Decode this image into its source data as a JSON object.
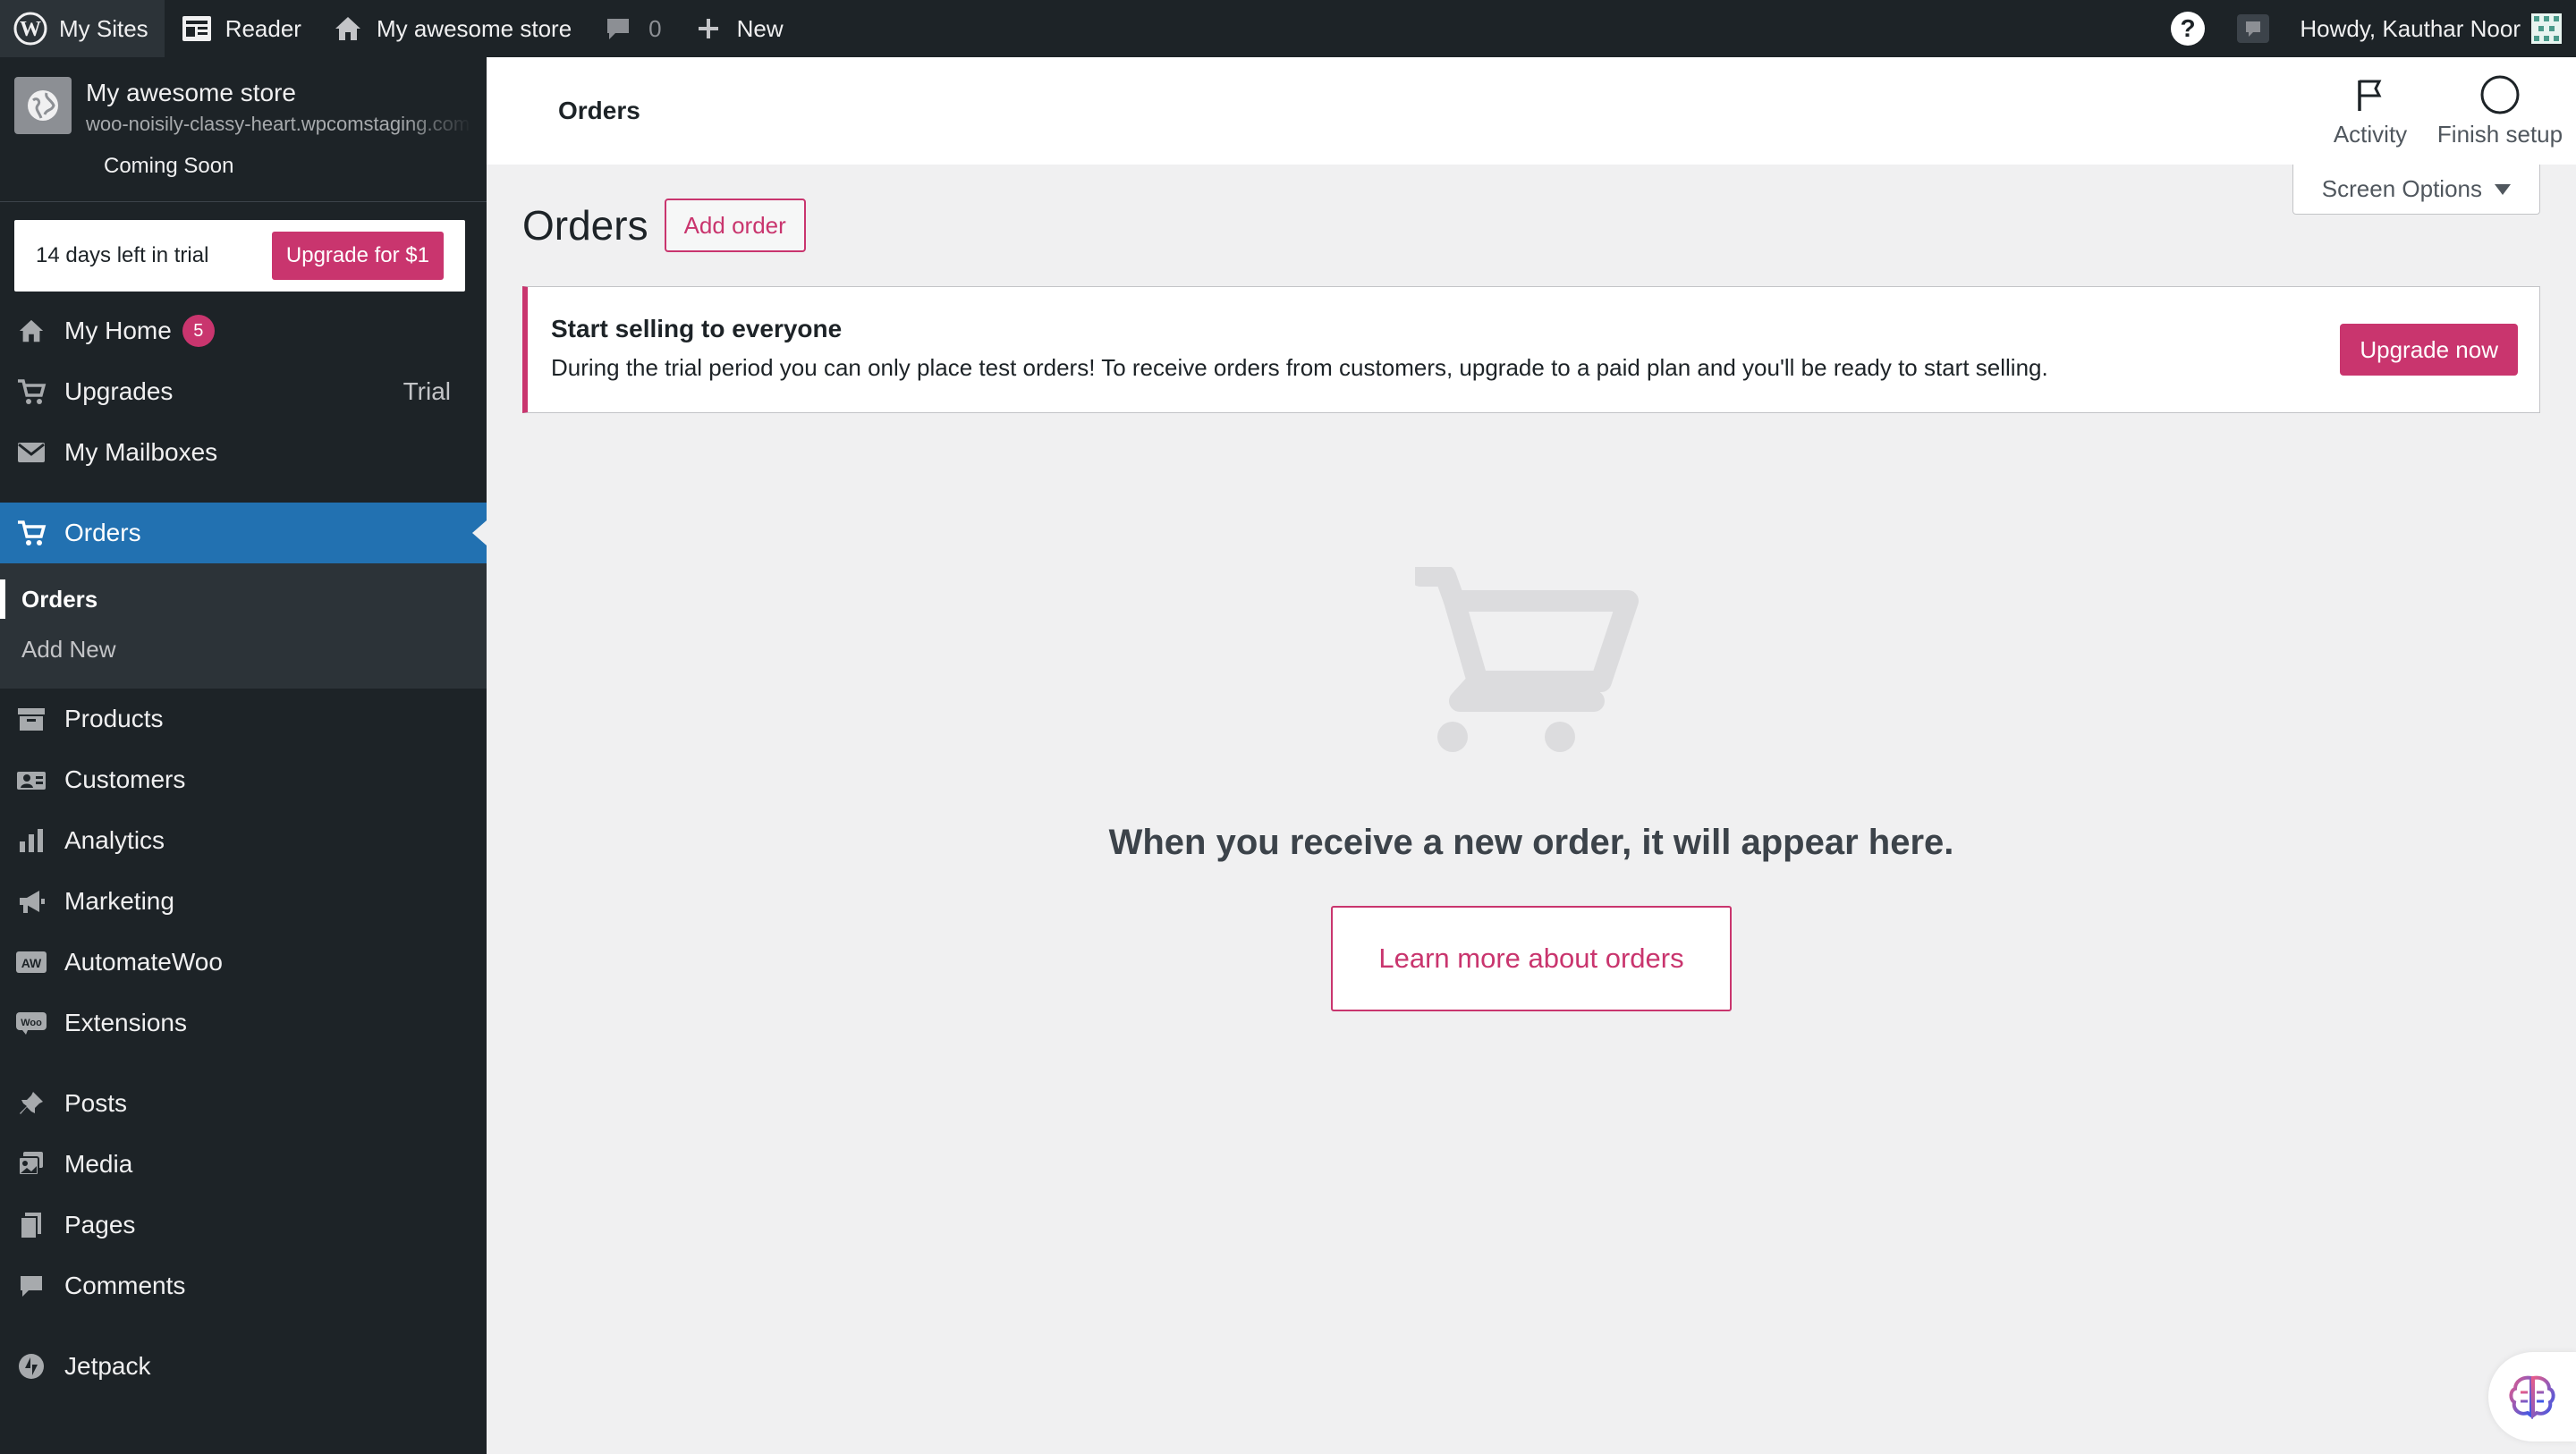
{
  "adminbar": {
    "my_sites": "My Sites",
    "reader": "Reader",
    "site": "My awesome store",
    "comments_count": "0",
    "new": "New",
    "howdy": "Howdy, Kauthar Noor"
  },
  "sidebar": {
    "site_name": "My awesome store",
    "site_url": "woo-noisily-classy-heart.wpcomstaging.com",
    "site_status": "Coming Soon",
    "trial_text": "14 days left in trial",
    "trial_button": "Upgrade for $1",
    "items": [
      {
        "label": "My Home",
        "icon": "home-icon",
        "badge": "5"
      },
      {
        "label": "Upgrades",
        "icon": "cart-icon",
        "extra": "Trial"
      },
      {
        "label": "My Mailboxes",
        "icon": "mail-icon"
      },
      {
        "label": "Orders",
        "icon": "cart-icon",
        "active": true
      },
      {
        "label": "Products",
        "icon": "archive-icon"
      },
      {
        "label": "Customers",
        "icon": "customers-icon"
      },
      {
        "label": "Analytics",
        "icon": "bar-chart-icon"
      },
      {
        "label": "Marketing",
        "icon": "megaphone-icon"
      },
      {
        "label": "AutomateWoo",
        "icon": "automatewoo-icon"
      },
      {
        "label": "Extensions",
        "icon": "woo-icon"
      },
      {
        "label": "Posts",
        "icon": "pin-icon"
      },
      {
        "label": "Media",
        "icon": "media-icon"
      },
      {
        "label": "Pages",
        "icon": "pages-icon"
      },
      {
        "label": "Comments",
        "icon": "comment-icon"
      },
      {
        "label": "Jetpack",
        "icon": "jetpack-icon"
      }
    ],
    "orders_submenu": [
      "Orders",
      "Add New"
    ]
  },
  "header": {
    "title": "Orders",
    "activity": "Activity",
    "finish_setup": "Finish setup"
  },
  "main": {
    "screen_options": "Screen Options",
    "page_title": "Orders",
    "add_order": "Add order",
    "notice_title": "Start selling to everyone",
    "notice_text": "During the trial period you can only place test orders! To receive orders from customers, upgrade to a paid plan and you'll be ready to start selling.",
    "upgrade_now": "Upgrade now",
    "empty_message": "When you receive a new order, it will appear here.",
    "learn_more": "Learn more about orders"
  },
  "colors": {
    "admin_bar": "#1d2327",
    "active_menu": "#2271b1",
    "accent": "#c9356e",
    "background": "#f0f0f1"
  }
}
